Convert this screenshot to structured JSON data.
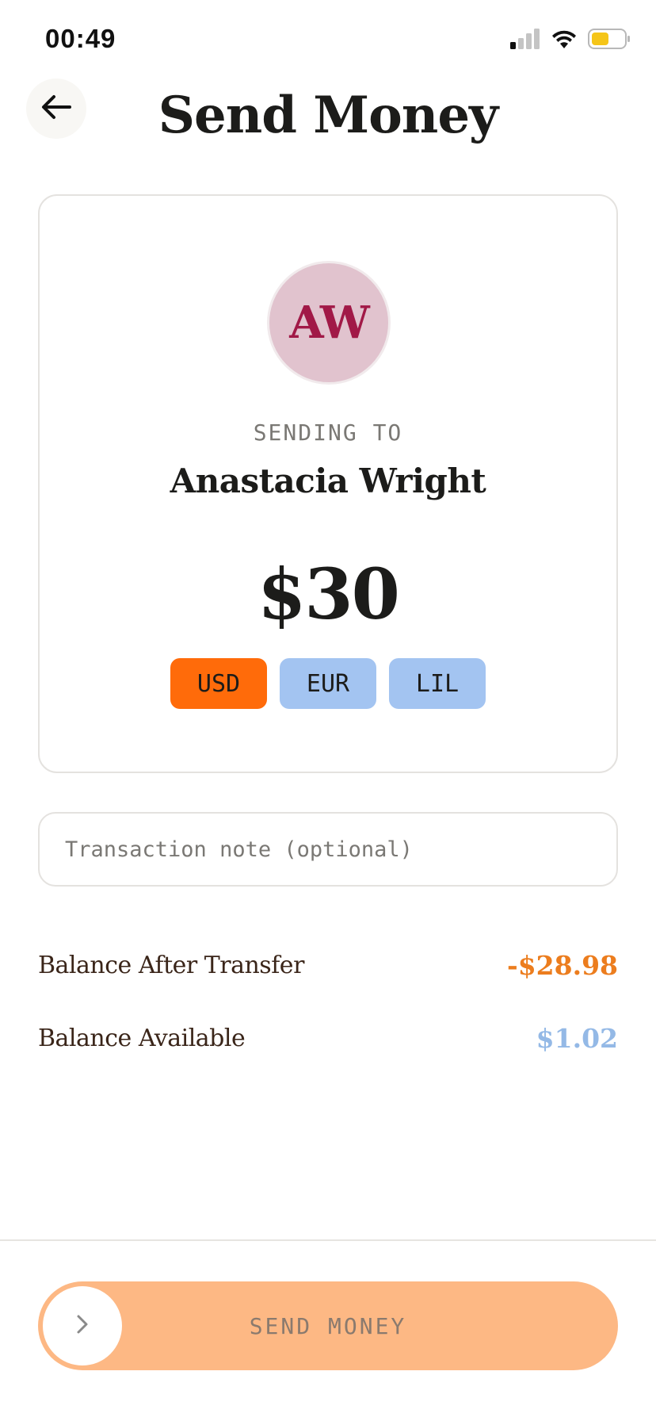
{
  "status_bar": {
    "time": "00:49",
    "icons": [
      "cellular-signal-icon",
      "wifi-icon",
      "battery-icon"
    ],
    "battery_color": "#f5c518"
  },
  "header": {
    "back_icon": "arrow-left-icon",
    "title": "Send Money"
  },
  "recipient": {
    "initials": "AW",
    "sending_to_label": "SENDING TO",
    "name": "Anastacia Wright",
    "avatar_bg": "#e1c3ce",
    "avatar_text_color": "#a11947"
  },
  "amount": {
    "display": "$30"
  },
  "currencies": {
    "selected": "USD",
    "options": [
      "USD",
      "EUR",
      "LIL"
    ],
    "selected_color": "#ff6b0a",
    "unselected_color": "#a3c4f1"
  },
  "note": {
    "placeholder": "Transaction note (optional)",
    "value": ""
  },
  "balances": {
    "after_label": "Balance After Transfer",
    "after_value": "-$28.98",
    "available_label": "Balance Available",
    "available_value": "$1.02",
    "negative_color": "#ec7d1e",
    "positive_color": "#94b9e6"
  },
  "send_slider": {
    "label": "SEND MONEY",
    "handle_icon": "chevron-right-icon",
    "color": "#fdb884"
  }
}
